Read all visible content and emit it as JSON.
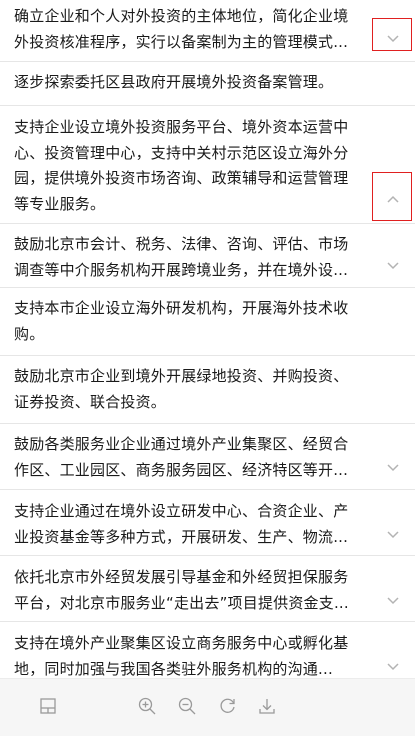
{
  "items": [
    {
      "text": "确立企业和个人对外投资的主体地位，简化企业境外投资核准程序，实行以备案制为主的管理模式...",
      "chevron": "chevron-down-icon"
    },
    {
      "text": "逐步探索委托区县政府开展境外投资备案管理。",
      "chevron": ""
    },
    {
      "text": "支持企业设立境外投资服务平台、境外资本运营中心、投资管理中心，支持中关村示范区设立海外分园，提供境外投资市场咨询、政策辅导和运营管理等专业服务。",
      "chevron": "chevron-up-icon"
    },
    {
      "text": "鼓励北京市会计、税务、法律、咨询、评估、市场调查等中介服务机构开展跨境业务，并在境外设...",
      "chevron": "chevron-down-icon"
    },
    {
      "text": "支持本市企业设立海外研发机构，开展海外技术收购。",
      "chevron": ""
    },
    {
      "text": "鼓励北京市企业到境外开展绿地投资、并购投资、证券投资、联合投资。",
      "chevron": ""
    },
    {
      "text": "鼓励各类服务业企业通过境外产业集聚区、经贸合作区、工业园区、商务服务园区、经济特区等开...",
      "chevron": "chevron-down-icon"
    },
    {
      "text": "支持企业通过在境外设立研发中心、合资企业、产业投资基金等多种方式，开展研发、生产、物流...",
      "chevron": "chevron-down-icon"
    },
    {
      "text": "依托北京市外经贸发展引导基金和外经贸担保服务平台，对北京市服务业“走出去”项目提供资金支...",
      "chevron": "chevron-down-icon"
    },
    {
      "text": "支持在境外产业聚集区设立商务服务中心或孵化基地，同时加强与我国各类驻外服务机构的沟通...",
      "chevron": "chevron-down-icon"
    }
  ],
  "toolbar": {
    "icons": [
      "layout-icon",
      "zoom-in-icon",
      "zoom-out-icon",
      "refresh-icon",
      "download-icon"
    ]
  },
  "colors": {
    "text": "#1a1a1a",
    "divider": "#e6e6e6",
    "chevron": "#b3b3b3",
    "highlight": "#e02020",
    "toolbar_bg": "#f6f6f6",
    "toolbar_icon": "#9a9a9a"
  }
}
